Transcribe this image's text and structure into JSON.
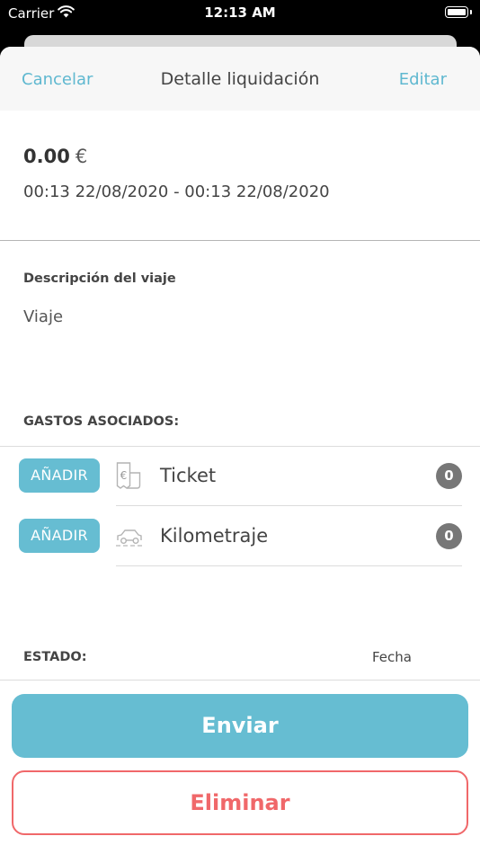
{
  "status_bar": {
    "carrier": "Carrier",
    "time": "12:13 AM"
  },
  "navbar": {
    "cancel_label": "Cancelar",
    "title": "Detalle liquidación",
    "edit_label": "Editar"
  },
  "summary": {
    "amount": "0.00",
    "currency": "€",
    "date_range": "00:13 22/08/2020 - 00:13 22/08/2020"
  },
  "description": {
    "label": "Descripción del viaje",
    "value": "Viaje"
  },
  "expenses": {
    "label": "GASTOS ASOCIADOS:",
    "items": [
      {
        "add_label": "AÑADIR",
        "icon": "ticket-euro-icon",
        "label": "Ticket",
        "count": "0"
      },
      {
        "add_label": "AÑADIR",
        "icon": "car-icon",
        "label": "Kilometraje",
        "count": "0"
      }
    ]
  },
  "status": {
    "label": "ESTADO:",
    "date_label": "Fecha"
  },
  "actions": {
    "send_label": "Enviar",
    "delete_label": "Eliminar"
  },
  "colors": {
    "accent": "#66bdd2",
    "danger": "#f0686a",
    "nav_link": "#5fb8d0"
  }
}
